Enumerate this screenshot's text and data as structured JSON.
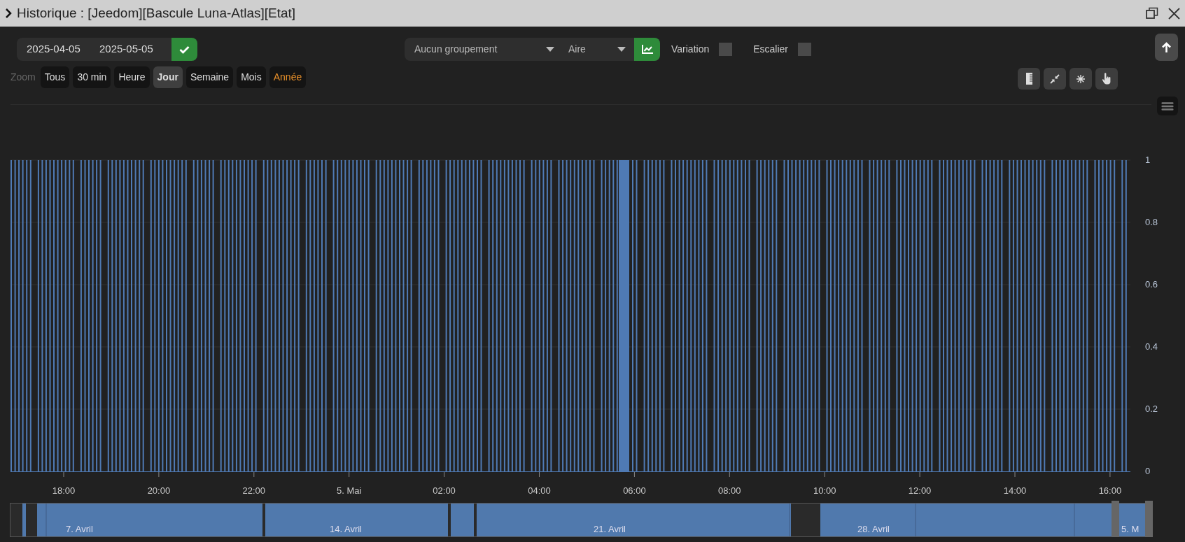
{
  "window": {
    "title": "Historique : [Jeedom][Bascule Luna-Atlas][Etat]"
  },
  "date_range": {
    "start": "2025-04-05",
    "end": "2025-05-05"
  },
  "grouping_select": {
    "value": "Aucun groupement"
  },
  "type_select": {
    "value": "Aire"
  },
  "options": [
    {
      "label": "Variation",
      "checked": false
    },
    {
      "label": "Escalier",
      "checked": false
    }
  ],
  "zoom": {
    "label": "Zoom",
    "buttons": [
      {
        "label": "Tous",
        "selected": false,
        "accent": false
      },
      {
        "label": "30 min",
        "selected": false,
        "accent": false
      },
      {
        "label": "Heure",
        "selected": false,
        "accent": false
      },
      {
        "label": "Jour",
        "selected": true,
        "accent": false
      },
      {
        "label": "Semaine",
        "selected": false,
        "accent": false
      },
      {
        "label": "Mois",
        "selected": false,
        "accent": false
      },
      {
        "label": "Année",
        "selected": false,
        "accent": true
      }
    ]
  },
  "chart": {
    "y_labels": [
      "1",
      "0.8",
      "0.6",
      "0.4",
      "0.2",
      "0"
    ],
    "x_labels": [
      "18:00",
      "20:00",
      "22:00",
      "5. Mai",
      "02:00",
      "04:00",
      "06:00",
      "08:00",
      "10:00",
      "12:00",
      "14:00",
      "16:00"
    ],
    "navigator_labels": [
      "7. Avril",
      "14. Avril",
      "21. Avril",
      "28. Avril",
      "5. M"
    ]
  }
}
